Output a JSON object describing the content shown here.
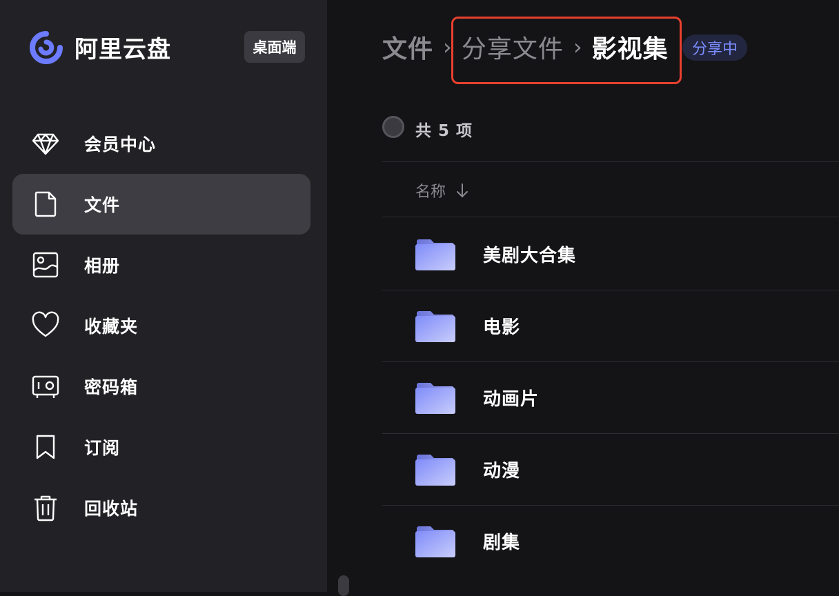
{
  "app": {
    "name": "阿里云盘",
    "badge": "桌面端",
    "accent_color": "#6d7bff"
  },
  "sidebar": {
    "items": [
      {
        "label": "会员中心",
        "icon": "diamond-icon",
        "active": false
      },
      {
        "label": "文件",
        "icon": "file-icon",
        "active": true
      },
      {
        "label": "相册",
        "icon": "photo-album-icon",
        "active": false
      },
      {
        "label": "收藏夹",
        "icon": "heart-icon",
        "active": false
      },
      {
        "label": "密码箱",
        "icon": "safe-icon",
        "active": false
      },
      {
        "label": "订阅",
        "icon": "bookmark-icon",
        "active": false
      },
      {
        "label": "回收站",
        "icon": "trash-icon",
        "active": false
      }
    ]
  },
  "breadcrumb": {
    "root": "文件",
    "parent": "分享文件",
    "current": "影视集",
    "separator": "›",
    "status_badge": "分享中"
  },
  "list": {
    "count_label": "共 5 项",
    "column_name": "名称",
    "sort_icon": "arrow-down-icon",
    "items": [
      {
        "name": "美剧大合集",
        "icon": "folder-icon"
      },
      {
        "name": "电影",
        "icon": "folder-icon"
      },
      {
        "name": "动画片",
        "icon": "folder-icon"
      },
      {
        "name": "动漫",
        "icon": "folder-icon"
      },
      {
        "name": "剧集",
        "icon": "folder-icon"
      }
    ]
  }
}
